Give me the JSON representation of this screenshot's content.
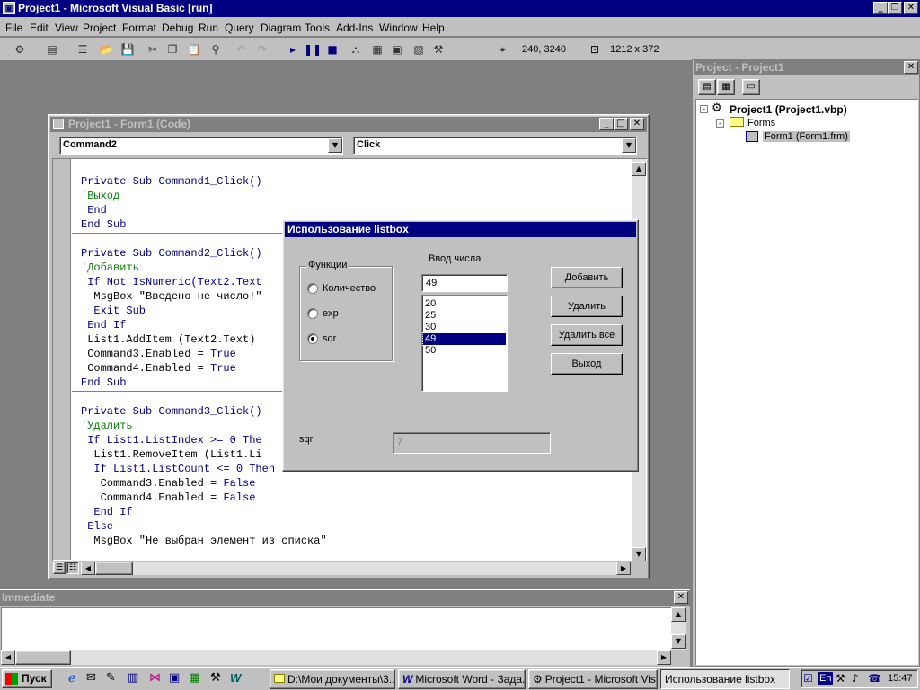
{
  "app_title": "Project1 - Microsoft Visual Basic [run]",
  "menu": [
    "File",
    "Edit",
    "View",
    "Project",
    "Format",
    "Debug",
    "Run",
    "Query",
    "Diagram",
    "Tools",
    "Add-Ins",
    "Window",
    "Help"
  ],
  "toolbar": {
    "position": "240, 3240",
    "size": "1212 x 372"
  },
  "code_window": {
    "title": "Project1 - Form1 (Code)",
    "object_combo": "Command2",
    "proc_combo": "Click"
  },
  "code": {
    "l1": "Private Sub Command1_Click()",
    "l2": "'Выход",
    "l3": " End",
    "l4": "End Sub",
    "l5": "Private Sub Command2_Click()",
    "l6": "'Добавить",
    "l7": " If Not IsNumeric(Text2.Text",
    "l8": "  MsgBox \"Введено не число!\"",
    "l9": "  Exit Sub",
    "l10": " End If",
    "l11": " List1.AddItem (Text2.Text)",
    "l12a": " Command3.Enabled = ",
    "l12b": "True",
    "l13a": " Command4.Enabled = ",
    "l13b": "True",
    "l14": "End Sub",
    "l15": "Private Sub Command3_Click()",
    "l16": "'Удалить",
    "l17": " If List1.ListIndex >= 0 The",
    "l18": "  List1.RemoveItem (List1.Li",
    "l19": "  If List1.ListCount <= 0 Then",
    "l20a": "   Command3.Enabled = ",
    "l20b": "False",
    "l21a": "   Command4.Enabled = ",
    "l21b": "False",
    "l22": "  End If",
    "l23": " Else",
    "l24": "  MsgBox \"Не выбран элемент из списка\""
  },
  "project_explorer": {
    "title": "Project - Project1",
    "root": "Project1 (Project1.vbp)",
    "folder": "Forms",
    "form": "Form1 (Form1.frm)"
  },
  "immediate": {
    "title": "Immediate"
  },
  "dialog": {
    "title": "Использование listbox",
    "group_label": "Функции",
    "radios": [
      "Количество",
      "exp",
      "sqr"
    ],
    "selected_radio": 2,
    "input_label": "Ввод числа",
    "input_value": "49",
    "list_items": [
      "20",
      "25",
      "30",
      "49",
      "50"
    ],
    "selected_item": 3,
    "buttons": [
      "Добавить",
      "Удалить",
      "Удалить все",
      "Выход"
    ],
    "result_label": "sqr",
    "result_value": "7"
  },
  "taskbar": {
    "start": "Пуск",
    "tasks": [
      "D:\\Мои документы\\3...",
      "Microsoft Word - Зада...",
      "Project1 - Microsoft Vis...",
      "Использование listbox"
    ],
    "lang": "En",
    "clock": "15:47"
  }
}
